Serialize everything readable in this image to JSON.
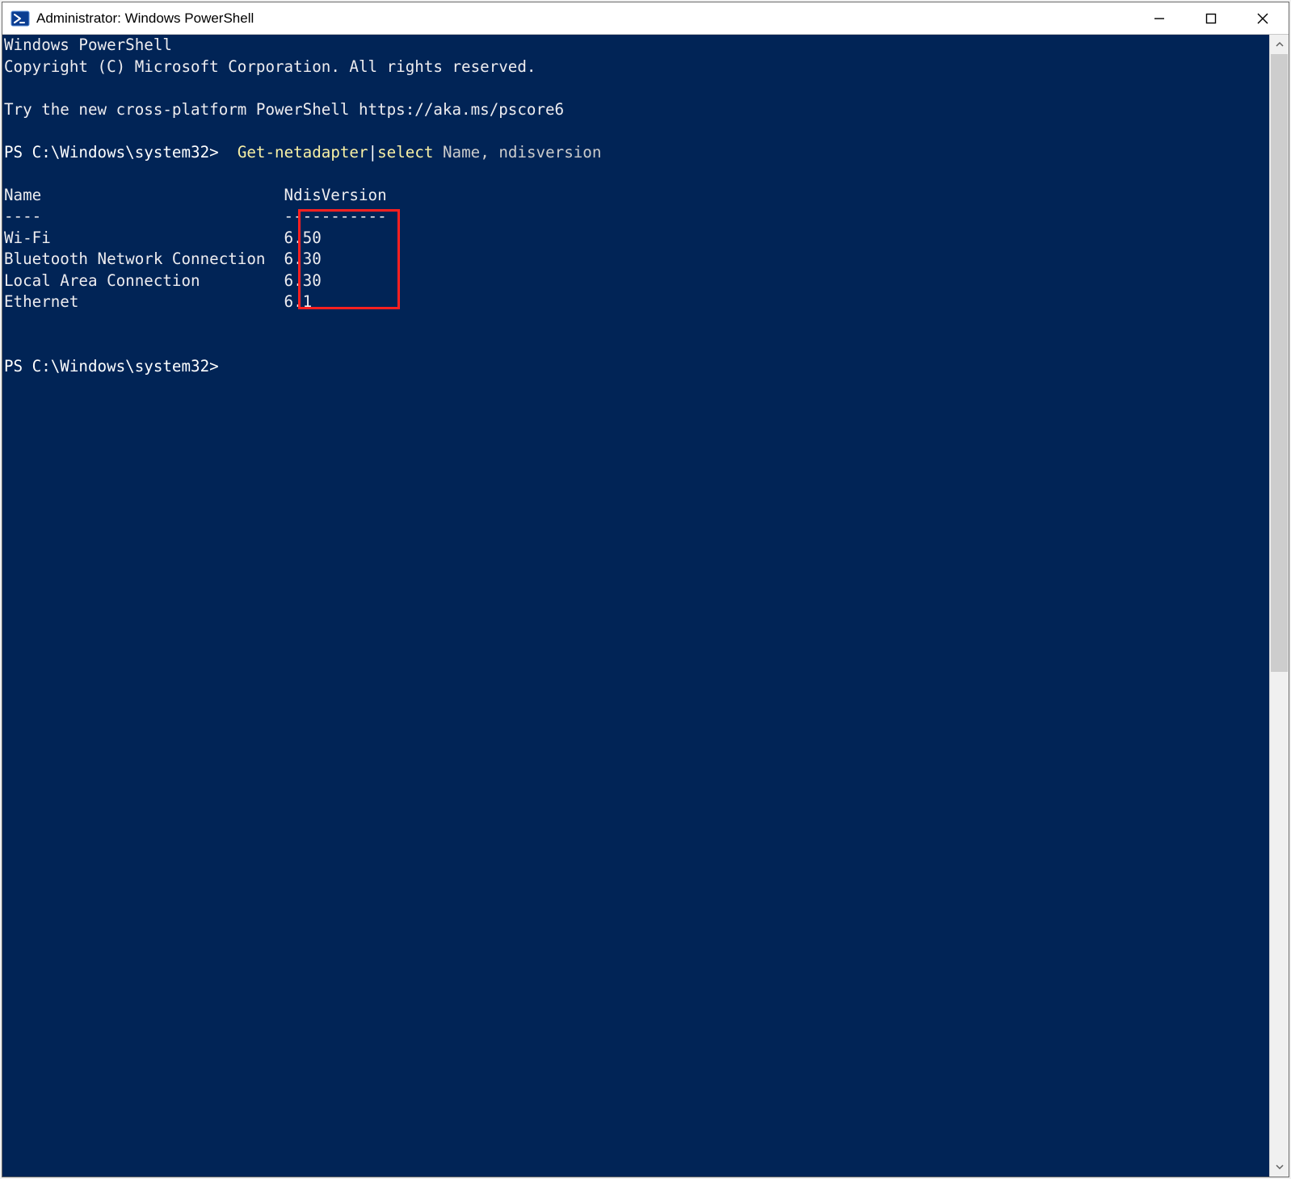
{
  "window": {
    "title": "Administrator: Windows PowerShell"
  },
  "console": {
    "banner": {
      "line1": "Windows PowerShell",
      "line2": "Copyright (C) Microsoft Corporation. All rights reserved.",
      "line3": "Try the new cross-platform PowerShell https://aka.ms/pscore6"
    },
    "prompt1": "PS C:\\Windows\\system32>",
    "command": {
      "cmdlet": "Get-netadapter",
      "pipe": "|",
      "select_kw": "select",
      "select_arg1": "Name",
      "select_comma": ",",
      "select_arg2": "ndisversion"
    },
    "table": {
      "header_name": "Name",
      "header_version": "NdisVersion",
      "sep_name": "----",
      "sep_version": "-----------",
      "rows": [
        {
          "name": "Wi-Fi",
          "version": "6.50"
        },
        {
          "name": "Bluetooth Network Connection",
          "version": "6.30"
        },
        {
          "name": "Local Area Connection",
          "version": "6.30"
        },
        {
          "name": "Ethernet",
          "version": "6.1"
        }
      ]
    },
    "prompt2": "PS C:\\Windows\\system32>"
  }
}
